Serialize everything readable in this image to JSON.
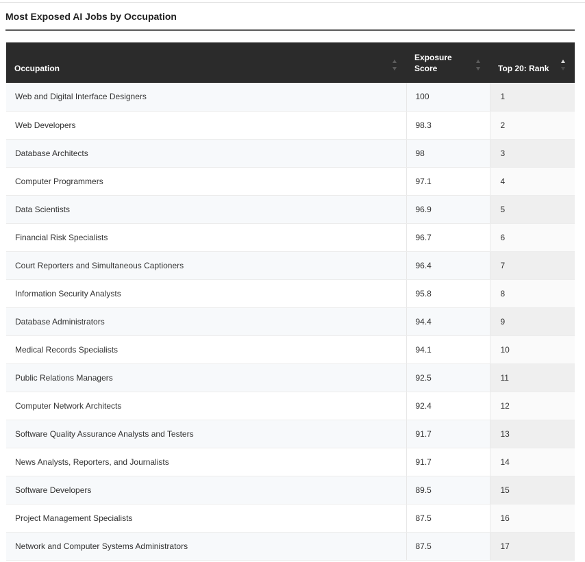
{
  "title": "Most Exposed AI Jobs by Occupation",
  "table": {
    "headers": {
      "occupation": "Occupation",
      "score": "Exposure Score",
      "rank": "Top 20: Rank"
    },
    "sort": {
      "column": "rank",
      "direction": "ascending"
    },
    "rows": [
      {
        "occupation": "Web and Digital Interface Designers",
        "score": "100",
        "rank": "1"
      },
      {
        "occupation": "Web Developers",
        "score": "98.3",
        "rank": "2"
      },
      {
        "occupation": "Database Architects",
        "score": "98",
        "rank": "3"
      },
      {
        "occupation": "Computer Programmers",
        "score": "97.1",
        "rank": "4"
      },
      {
        "occupation": "Data Scientists",
        "score": "96.9",
        "rank": "5"
      },
      {
        "occupation": "Financial Risk Specialists",
        "score": "96.7",
        "rank": "6"
      },
      {
        "occupation": "Court Reporters and Simultaneous Captioners",
        "score": "96.4",
        "rank": "7"
      },
      {
        "occupation": "Information Security Analysts",
        "score": "95.8",
        "rank": "8"
      },
      {
        "occupation": "Database Administrators",
        "score": "94.4",
        "rank": "9"
      },
      {
        "occupation": "Medical Records Specialists",
        "score": "94.1",
        "rank": "10"
      },
      {
        "occupation": "Public Relations Managers",
        "score": "92.5",
        "rank": "11"
      },
      {
        "occupation": "Computer Network Architects",
        "score": "92.4",
        "rank": "12"
      },
      {
        "occupation": "Software Quality Assurance Analysts and Testers",
        "score": "91.7",
        "rank": "13"
      },
      {
        "occupation": "News Analysts, Reporters, and Journalists",
        "score": "91.7",
        "rank": "14"
      },
      {
        "occupation": "Software Developers",
        "score": "89.5",
        "rank": "15"
      },
      {
        "occupation": "Project Management Specialists",
        "score": "87.5",
        "rank": "16"
      },
      {
        "occupation": "Network and Computer Systems Administrators",
        "score": "87.5",
        "rank": "17"
      }
    ]
  },
  "colors": {
    "header_bg": "#2b2b2b",
    "header_text": "#ffffff",
    "rank_column_bg": "#efefef"
  },
  "icons": {
    "sort": "sort-arrows-icon",
    "sort_active": "sort-ascending-icon"
  }
}
